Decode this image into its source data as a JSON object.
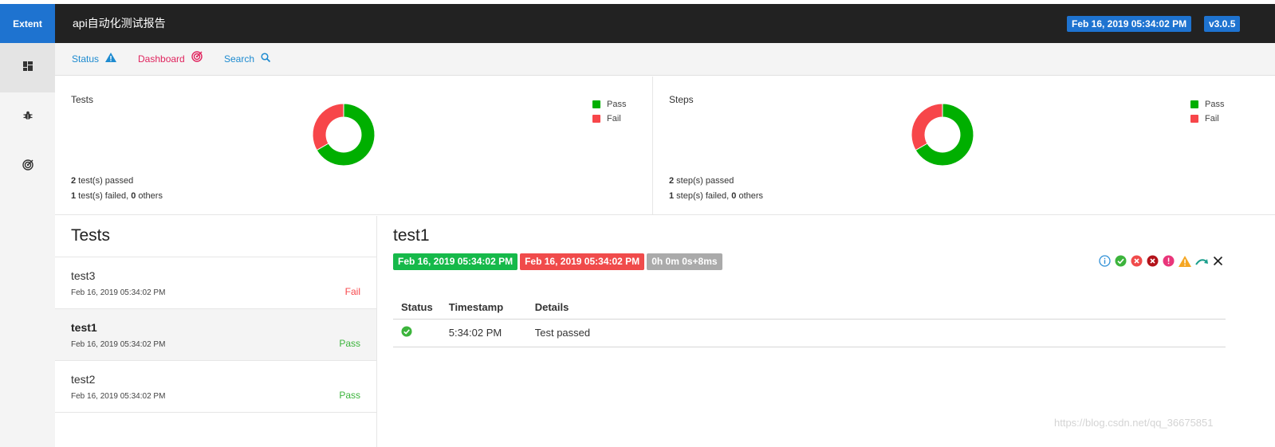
{
  "header": {
    "brand": "Extent",
    "report_name": "api自动化测试报告",
    "timestamp": "Feb 16, 2019 05:34:02 PM",
    "version": "v3.0.5"
  },
  "subnav": {
    "status": "Status",
    "dashboard": "Dashboard",
    "search": "Search"
  },
  "sidebar": {
    "items": [
      "dashboard-icon",
      "bug-icon",
      "dashboard-target-icon"
    ]
  },
  "tests_panel": {
    "title": "Tests",
    "legend": [
      "Pass",
      "Fail"
    ],
    "passed_count": "2",
    "passed_text": " test(s) passed",
    "failed_count": "1",
    "failed_text": " test(s) failed, ",
    "others_count": "0",
    "others_text": " others"
  },
  "steps_panel": {
    "title": "Steps",
    "legend": [
      "Pass",
      "Fail"
    ],
    "passed_count": "2",
    "passed_text": " step(s) passed",
    "failed_count": "1",
    "failed_text": " step(s) failed, ",
    "others_count": "0",
    "others_text": " others"
  },
  "chart_data": [
    {
      "type": "pie",
      "title": "Tests",
      "categories": [
        "Pass",
        "Fail"
      ],
      "values": [
        2,
        1
      ],
      "colors": [
        "#00af00",
        "#f7464a"
      ],
      "legend": "top-right"
    },
    {
      "type": "pie",
      "title": "Steps",
      "categories": [
        "Pass",
        "Fail"
      ],
      "values": [
        2,
        1
      ],
      "colors": [
        "#00af00",
        "#f7464a"
      ],
      "legend": "top-right"
    }
  ],
  "test_list": {
    "heading": "Tests",
    "items": [
      {
        "name": "test3",
        "time": "Feb 16, 2019 05:34:02 PM",
        "status": "Fail"
      },
      {
        "name": "test1",
        "time": "Feb 16, 2019 05:34:02 PM",
        "status": "Pass"
      },
      {
        "name": "test2",
        "time": "Feb 16, 2019 05:34:02 PM",
        "status": "Pass"
      }
    ]
  },
  "detail": {
    "title": "test1",
    "start_time": "Feb 16, 2019 05:34:02 PM",
    "end_time": "Feb 16, 2019 05:34:02 PM",
    "duration": "0h 0m 0s+8ms",
    "table": {
      "headers": [
        "Status",
        "Timestamp",
        "Details"
      ],
      "rows": [
        {
          "status_icon": "check-circle-icon",
          "timestamp": "5:34:02 PM",
          "details": "Test passed"
        }
      ]
    }
  },
  "colors": {
    "pass": "#00af00",
    "fail": "#f7464a",
    "brand": "#1e73d0",
    "navbar": "#222222",
    "link": "#1e8bd0",
    "dashboard_link": "#e0245e",
    "duration_gray": "#aaaaaa"
  },
  "watermark": "https://blog.csdn.net/qq_36675851"
}
